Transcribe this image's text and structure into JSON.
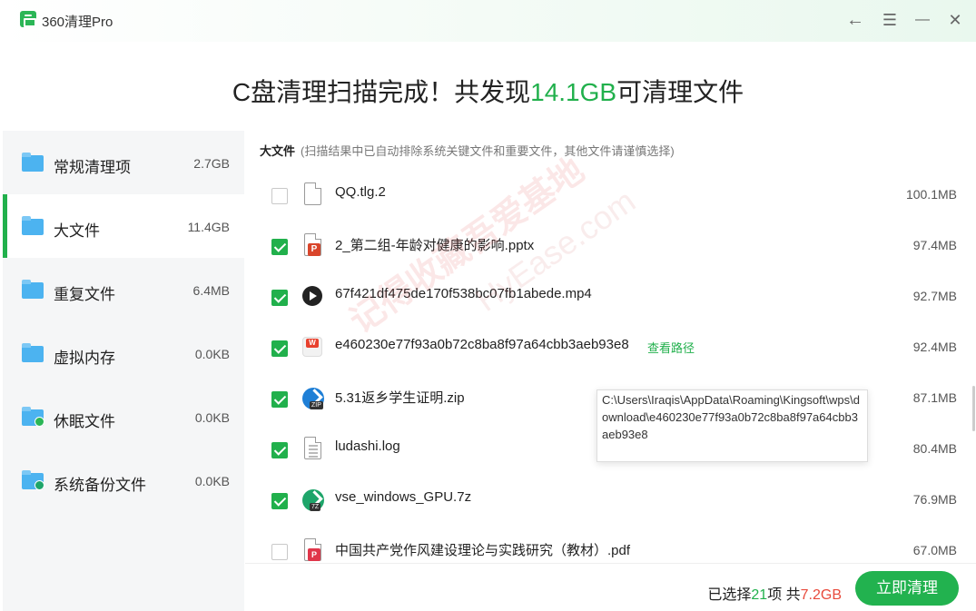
{
  "app": {
    "title": "360清理Pro"
  },
  "window_controls": {
    "back": "←",
    "menu": "☰",
    "minimize": "—",
    "close": "✕"
  },
  "headline": {
    "prefix": "C盘清理扫描完成！共发现",
    "amount": "14.1GB",
    "suffix": "可清理文件"
  },
  "sidebar": {
    "items": [
      {
        "label": "常规清理项",
        "size": "2.7GB",
        "icon": "folder-icon",
        "active": false
      },
      {
        "label": "大文件",
        "size": "11.4GB",
        "icon": "folder-icon",
        "active": true
      },
      {
        "label": "重复文件",
        "size": "6.4MB",
        "icon": "folder-icon",
        "active": false
      },
      {
        "label": "虚拟内存",
        "size": "0.0KB",
        "icon": "folder-icon",
        "active": false
      },
      {
        "label": "休眠文件",
        "size": "0.0KB",
        "icon": "folder-badge-icon",
        "active": false
      },
      {
        "label": "系统备份文件",
        "size": "0.0KB",
        "icon": "folder-badge-icon",
        "active": false
      }
    ]
  },
  "list": {
    "title": "大文件",
    "note": "(扫描结果中已自动排除系统关键文件和重要文件，其他文件请谨慎选择)",
    "view_path_label": "查看路径",
    "files": [
      {
        "name": "QQ.tlg.2",
        "size": "100.1MB",
        "checked": false,
        "icon": "document-icon"
      },
      {
        "name": "2_第二组-年龄对健康的影响.pptx",
        "size": "97.4MB",
        "checked": true,
        "icon": "ppt-file-icon"
      },
      {
        "name": "67f421df475de170f538bc07fb1abede.mp4",
        "size": "92.7MB",
        "checked": true,
        "icon": "video-file-icon"
      },
      {
        "name": "e460230e77f93a0b72c8ba8f97a64cbb3aeb93e8",
        "size": "92.4MB",
        "checked": true,
        "icon": "wps-file-icon"
      },
      {
        "name": "5.31返乡学生证明.zip",
        "size": "87.1MB",
        "checked": true,
        "icon": "zip-file-icon"
      },
      {
        "name": "ludashi.log",
        "size": "80.4MB",
        "checked": true,
        "icon": "log-file-icon"
      },
      {
        "name": "vse_windows_GPU.7z",
        "size": "76.9MB",
        "checked": true,
        "icon": "7z-file-icon"
      },
      {
        "name": "中国共产党作风建设理论与实践研究（教材）.pdf",
        "size": "67.0MB",
        "checked": false,
        "icon": "pdf-file-icon"
      }
    ]
  },
  "tooltip": {
    "text": "C:\\Users\\Iraqis\\AppData\\Roaming\\Kingsoft\\wps\\download\\e460230e77f93a0b72c8ba8f97a64cbb3aeb93e8"
  },
  "watermark": {
    "text1": "记得收藏吾爱基地",
    "text2": "HyEase.com"
  },
  "footer": {
    "selected_prefix": "已选择",
    "selected_count": "21",
    "selected_unit": "项 共",
    "selected_size": "7.2GB",
    "clean_button": "立即清理"
  },
  "colors": {
    "accent": "#21b04c",
    "danger": "#e84a3c"
  }
}
